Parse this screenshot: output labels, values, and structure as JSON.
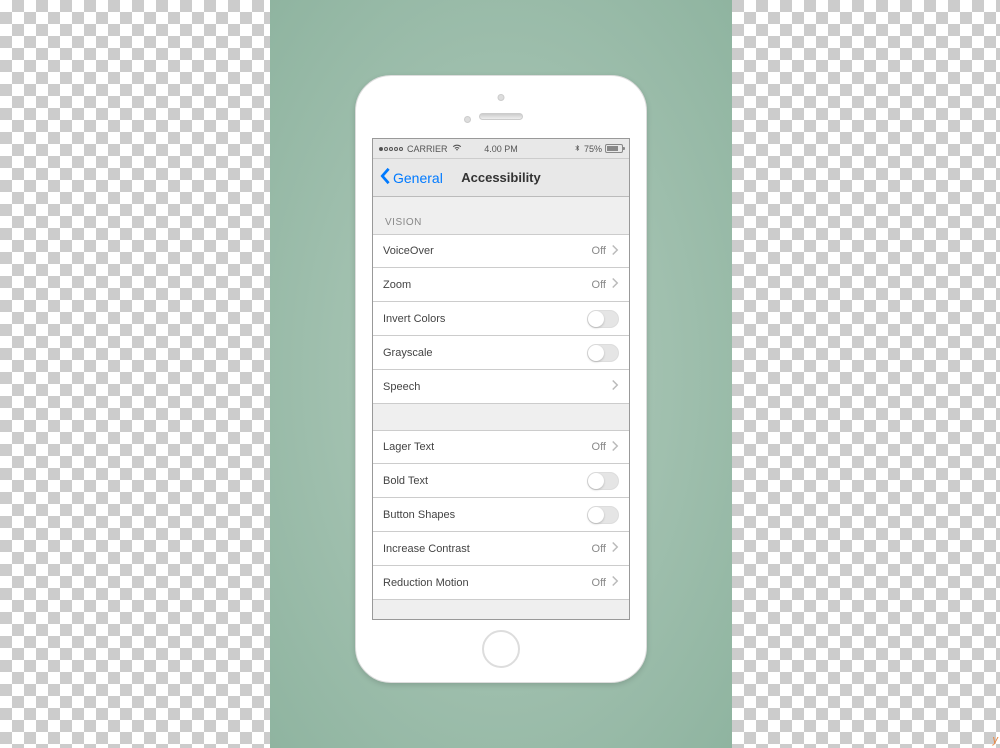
{
  "status": {
    "carrier": "CARRIER",
    "time": "4.00 PM",
    "battery_pct": "75%"
  },
  "nav": {
    "back_label": "General",
    "title": "Accessibility"
  },
  "sections": {
    "vision_header": "VISION",
    "items1": [
      {
        "label": "VoiceOver",
        "value": "Off",
        "kind": "link"
      },
      {
        "label": "Zoom",
        "value": "Off",
        "kind": "link"
      },
      {
        "label": "Invert Colors",
        "kind": "toggle",
        "on": false
      },
      {
        "label": "Grayscale",
        "kind": "toggle",
        "on": false
      },
      {
        "label": "Speech",
        "value": "",
        "kind": "link"
      }
    ],
    "items2": [
      {
        "label": "Lager Text",
        "value": "Off",
        "kind": "link"
      },
      {
        "label": "Bold Text",
        "kind": "toggle",
        "on": false
      },
      {
        "label": "Button Shapes",
        "kind": "toggle",
        "on": false
      },
      {
        "label": "Increase Contrast",
        "value": "Off",
        "kind": "link"
      },
      {
        "label": "Reduction Motion",
        "value": "Off",
        "kind": "link"
      }
    ]
  },
  "footer": {
    "credit": "y"
  }
}
